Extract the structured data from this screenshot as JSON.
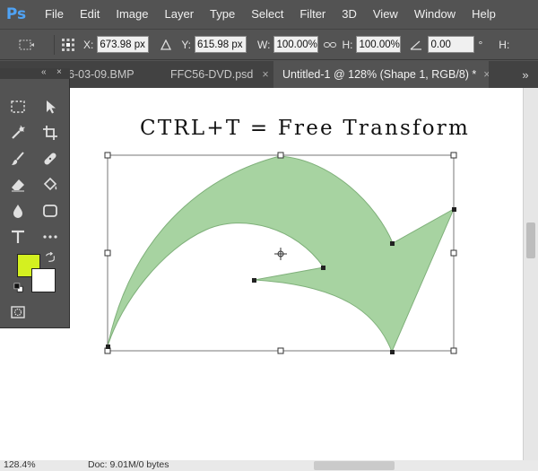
{
  "app": {
    "logo": "Ps"
  },
  "menu": [
    "File",
    "Edit",
    "Image",
    "Layer",
    "Type",
    "Select",
    "Filter",
    "3D",
    "View",
    "Window",
    "Help"
  ],
  "options": {
    "x_label": "X:",
    "x_value": "673.98 px",
    "y_label": "Y:",
    "y_value": "615.98 px",
    "w_label": "W:",
    "w_value": "100.00%",
    "h_label": "H:",
    "h_value": "100.00%",
    "angle_value": "0.00",
    "angle_unit": "°",
    "h2_label": "H:"
  },
  "tabs": [
    {
      "label": "6-03-09.BMP",
      "active": false
    },
    {
      "label": "FFC56-DVD.psd",
      "active": false
    },
    {
      "label": "Untitled-1 @ 128% (Shape 1, RGB/8) *",
      "active": true
    }
  ],
  "tab_close": "×",
  "tab_more": "»",
  "tools_panel": {
    "collapse": "«",
    "close": "×"
  },
  "canvas": {
    "heading": "CTRL+T = Free Transform",
    "shape_fill": "#a7d3a1",
    "shape_stroke": "#7fb07a"
  },
  "colors": {
    "foreground": "#d4f020",
    "background": "#ffffff"
  },
  "status": {
    "zoom": "128.4%",
    "doc": "Doc: 9.01M/0 bytes"
  },
  "icons": {
    "options": [
      "transform-origin-icon",
      "reference-point-icon",
      "delta-icon",
      "link-icon",
      "angle-icon"
    ],
    "tools": [
      "marquee-icon",
      "move-icon",
      "spot-healing-icon",
      "crop-icon",
      "brush-icon",
      "healing-icon",
      "eraser-icon",
      "paint-bucket-icon",
      "blur-icon",
      "shape-icon",
      "type-icon",
      "more-tools-icon",
      "swap-colors-icon",
      "default-colors-icon",
      "quick-mask-icon"
    ]
  }
}
